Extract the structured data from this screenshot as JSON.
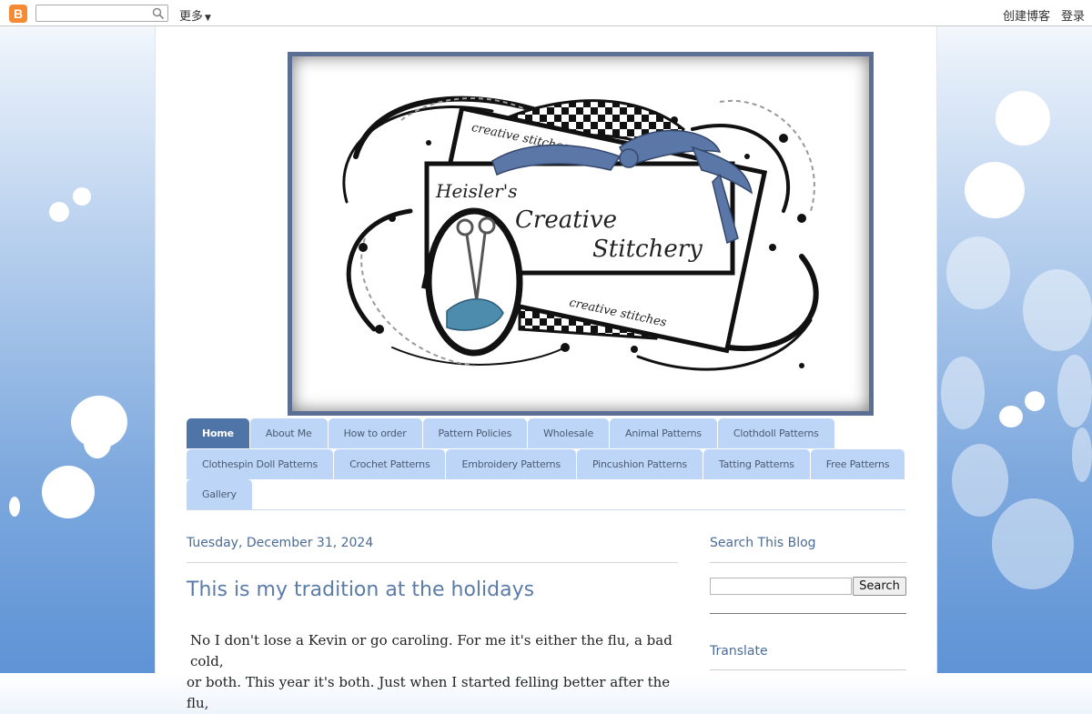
{
  "navbar": {
    "logo_letter": "B",
    "search_placeholder": "",
    "more_label": "更多",
    "create_blog_label": "创建博客",
    "login_label": "登录"
  },
  "header": {
    "line1": "Heisler's",
    "line2": "Creative",
    "line3": "Stitchery",
    "ribbon_text": "creative stitches"
  },
  "tabs": {
    "row1": [
      "Home",
      "About Me",
      "How to order",
      "Pattern Policies",
      "Wholesale",
      "Animal Patterns",
      "Clothdoll Patterns"
    ],
    "row2": [
      "Clothespin Doll Patterns",
      "Crochet Patterns",
      "Embroidery Patterns",
      "Pincushion Patterns",
      "Tatting Patterns",
      "Free Patterns"
    ],
    "row3": [
      "Gallery"
    ]
  },
  "post": {
    "date": "Tuesday, December 31, 2024",
    "title": "This is my tradition at the holidays",
    "body_line1": "No I don't lose a Kevin or go caroling. For me it's either the flu, a bad cold,",
    "body_line2": "or both. This year it's both. Just when I started felling better after the flu,"
  },
  "sidebar": {
    "search_title": "Search This Blog",
    "search_button": "Search",
    "translate_title": "Translate"
  },
  "colors": {
    "tab": "#bdd6f7",
    "tab_active": "#4e74a8",
    "accent_text": "#4a6b96",
    "frame": "#5a6f93"
  }
}
